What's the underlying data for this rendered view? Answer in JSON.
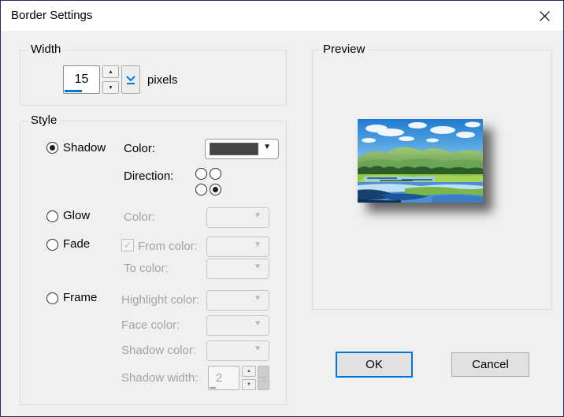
{
  "colors": {
    "accent": "#0078d7",
    "dialog_bg": "#f0f0f0",
    "titlebar_bg": "#ffffff",
    "window_border": "#252e63",
    "group_border": "#dcdcdc",
    "disabled_text": "#a3a3a3",
    "enabled_text": "#000000",
    "shadow_swatch": "#454545",
    "button_bg": "#e1e1e1",
    "button_border": "#adadad"
  },
  "icons": {
    "close": "✕",
    "spinner_up": "▲",
    "spinner_down": "▼",
    "dropdown_arrow": "▼",
    "checkmark": "✓"
  },
  "window": {
    "title": "Border Settings"
  },
  "width_group": {
    "label": "Width",
    "spinner_value": "15",
    "unit_label": "pixels"
  },
  "style_group": {
    "label": "Style",
    "shadow": {
      "radio_label": "Shadow",
      "selected": true,
      "color_label": "Color:",
      "direction_label": "Direction:",
      "direction_selected": "bottom-right"
    },
    "glow": {
      "radio_label": "Glow",
      "color_label": "Color:"
    },
    "fade": {
      "radio_label": "Fade",
      "from_color_label": "From color:",
      "from_color_checked": true,
      "to_color_label": "To color:"
    },
    "frame": {
      "radio_label": "Frame",
      "highlight_color_label": "Highlight color:",
      "face_color_label": "Face color:",
      "shadow_color_label": "Shadow color:",
      "shadow_width_label": "Shadow width:",
      "shadow_width_value": "2"
    }
  },
  "preview_group": {
    "label": "Preview",
    "image_alt": "landscape-photo"
  },
  "footer": {
    "ok_label": "OK",
    "cancel_label": "Cancel"
  }
}
